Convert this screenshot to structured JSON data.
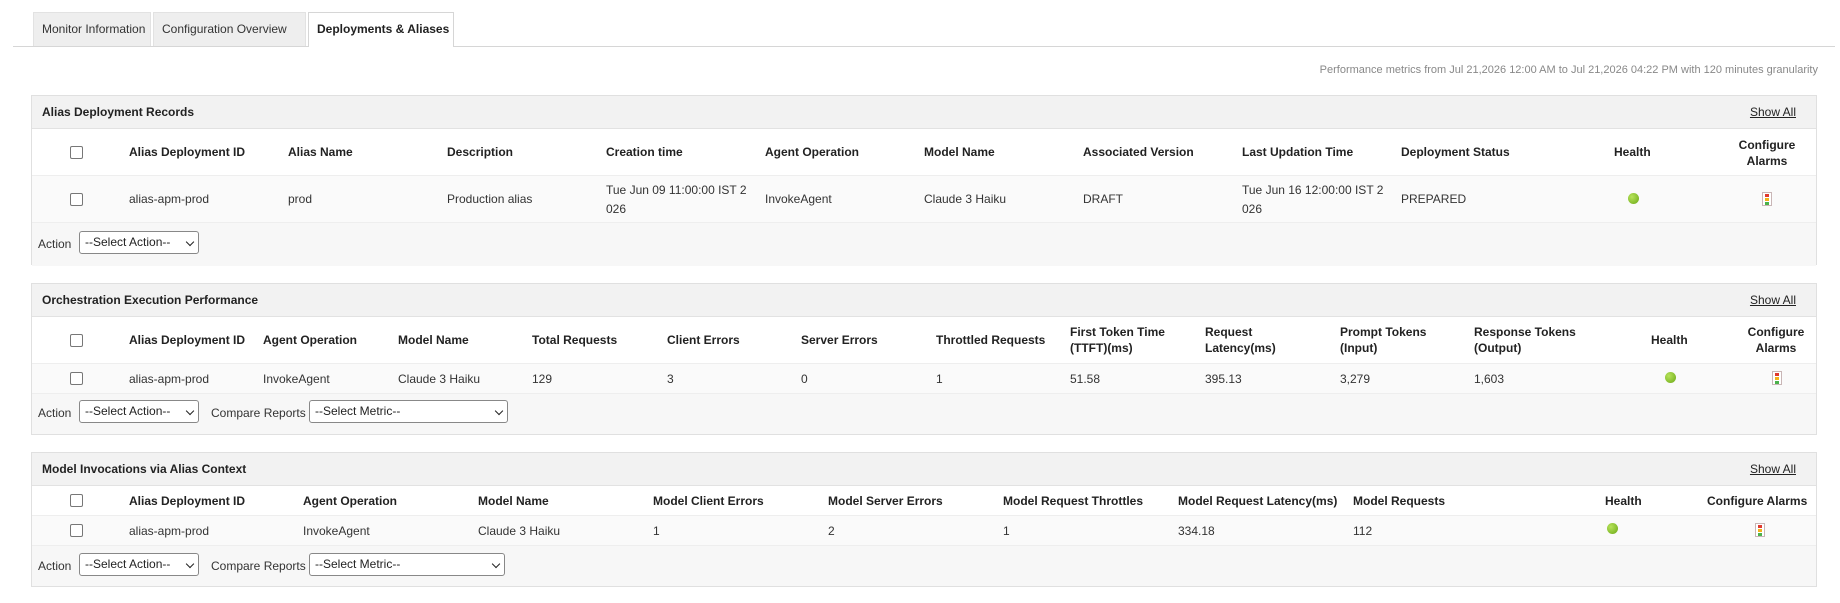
{
  "tabs": [
    {
      "label": "Monitor Information"
    },
    {
      "label": "Configuration Overview"
    },
    {
      "label": "Deployments & Aliases"
    }
  ],
  "perf_note": "Performance metrics from Jul 21,2026 12:00 AM to Jul 21,2026 04:22 PM with 120 minutes granularity",
  "common": {
    "show_all": "Show All",
    "action_label": "Action",
    "select_action": "--Select Action--",
    "compare_label": "Compare Reports",
    "select_metric": "--Select Metric--"
  },
  "alias_records": {
    "title": "Alias Deployment Records",
    "headers": [
      "Alias Deployment ID",
      "Alias Name",
      "Description",
      "Creation time",
      "Agent Operation",
      "Model Name",
      "Associated Version",
      "Last Updation Time",
      "Deployment Status",
      "Health",
      "Configure Alarms"
    ],
    "row": {
      "id": "alias-apm-prod",
      "alias_name": "prod",
      "description": "Production alias",
      "creation_line1": "Tue Jun 09 11:00:00 IST 2",
      "creation_line2": "026",
      "operation": "InvokeAgent",
      "model": "Claude 3 Haiku",
      "version": "DRAFT",
      "updated_line1": "Tue Jun 16 12:00:00 IST 2",
      "updated_line2": "026",
      "status": "PREPARED",
      "health": "healthy"
    }
  },
  "orchestration": {
    "title": "Orchestration Execution Performance",
    "headers": [
      "Alias Deployment ID",
      "Agent Operation",
      "Model Name",
      "Total Requests",
      "Client Errors",
      "Server Errors",
      "Throttled Requests",
      "First Token Time",
      "(TTFT)(ms)",
      "Request",
      "Latency(ms)",
      "Prompt Tokens",
      "(Input)",
      "Response Tokens",
      "(Output)",
      "Health",
      "Configure",
      "Alarms"
    ],
    "row": {
      "id": "alias-apm-prod",
      "operation": "InvokeAgent",
      "model": "Claude 3 Haiku",
      "total_requests": "129",
      "client_errors": "3",
      "server_errors": "0",
      "throttled": "1",
      "ttft": "51.58",
      "latency": "395.13",
      "prompt_tokens": "3,279",
      "response_tokens": "1,603",
      "health": "healthy"
    }
  },
  "model_invocations": {
    "title": "Model Invocations via Alias Context",
    "headers": [
      "Alias Deployment ID",
      "Agent Operation",
      "Model Name",
      "Model Client Errors",
      "Model Server Errors",
      "Model Request Throttles",
      "Model Request Latency(ms)",
      "Model Requests",
      "Health",
      "Configure Alarms"
    ],
    "row": {
      "id": "alias-apm-prod",
      "operation": "InvokeAgent",
      "model": "Claude 3 Haiku",
      "client_errors": "1",
      "server_errors": "2",
      "throttles": "1",
      "latency": "334.18",
      "requests": "112",
      "health": "healthy"
    }
  },
  "colors": {
    "health_ok": "#7dbb20",
    "alarm_red": "#e03a2f"
  }
}
